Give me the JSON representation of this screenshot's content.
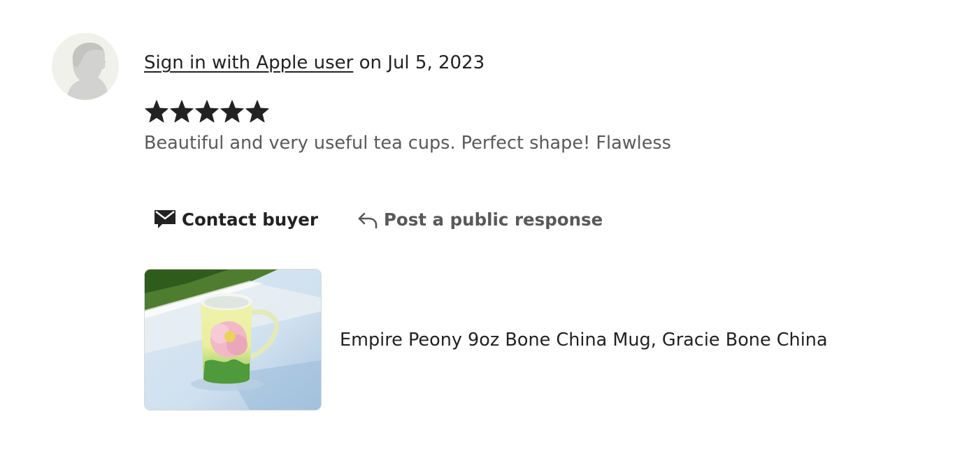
{
  "review": {
    "reviewer_name": "Sign in with Apple user",
    "date_text": "on Jul 5, 2023",
    "rating": 5,
    "rating_max": 5,
    "text": "Beautiful and very useful tea cups. Perfect shape! Flawless"
  },
  "actions": {
    "contact_label": "Contact buyer",
    "respond_label": "Post a public response"
  },
  "product": {
    "title": "Empire Peony 9oz Bone China Mug, Gracie Bone China"
  },
  "colors": {
    "text_primary": "#222222",
    "text_secondary": "#595959",
    "star": "#222222",
    "avatar_bg": "#f1f1ec",
    "avatar_silhouette": "#cfcfcf"
  },
  "icons": {
    "avatar": "user-silhouette-icon",
    "star": "star-icon",
    "contact": "envelope-icon",
    "respond": "reply-arrow-icon"
  }
}
